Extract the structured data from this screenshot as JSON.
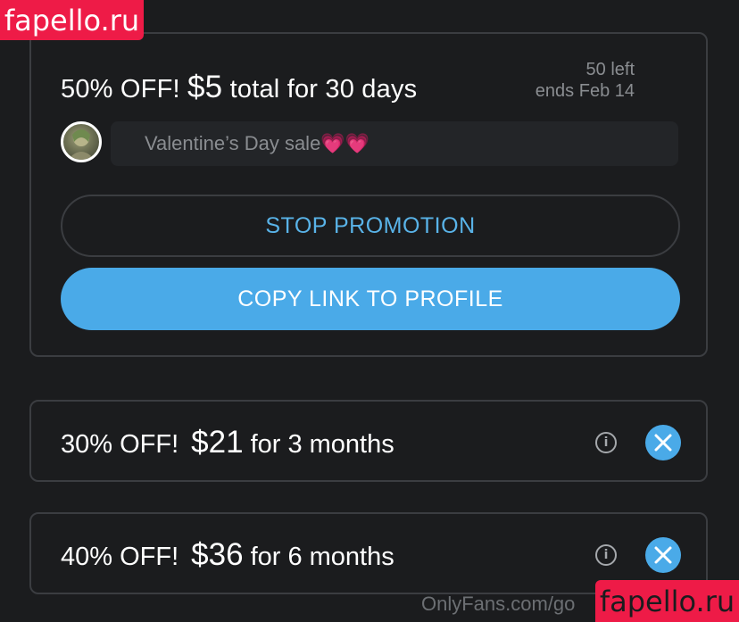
{
  "watermark": {
    "top_text": "fapello.ru",
    "bottom_text": "fapello.ru"
  },
  "promotion": {
    "title_prefix": "50% OFF!",
    "price": "$5",
    "title_suffix": "total for 30 days",
    "remaining": "50 left",
    "ends": "ends Feb 14",
    "message": "Valentine’s Day sale💗💗",
    "stop_button_label": "STOP PROMOTION",
    "copy_button_label": "COPY LINK TO PROFILE"
  },
  "offers": [
    {
      "discount": "30% OFF!",
      "price": "$21",
      "duration": "for 3 months"
    },
    {
      "discount": "40% OFF!",
      "price": "$36",
      "duration": "for 6 months"
    }
  ],
  "footer": {
    "url_text": "OnlyFans.com/go"
  },
  "colors": {
    "background": "#1b1c1e",
    "accent": "#4aaae8",
    "watermark": "#ee1b47"
  },
  "icons": {
    "info": "info-icon",
    "close": "close-icon"
  }
}
